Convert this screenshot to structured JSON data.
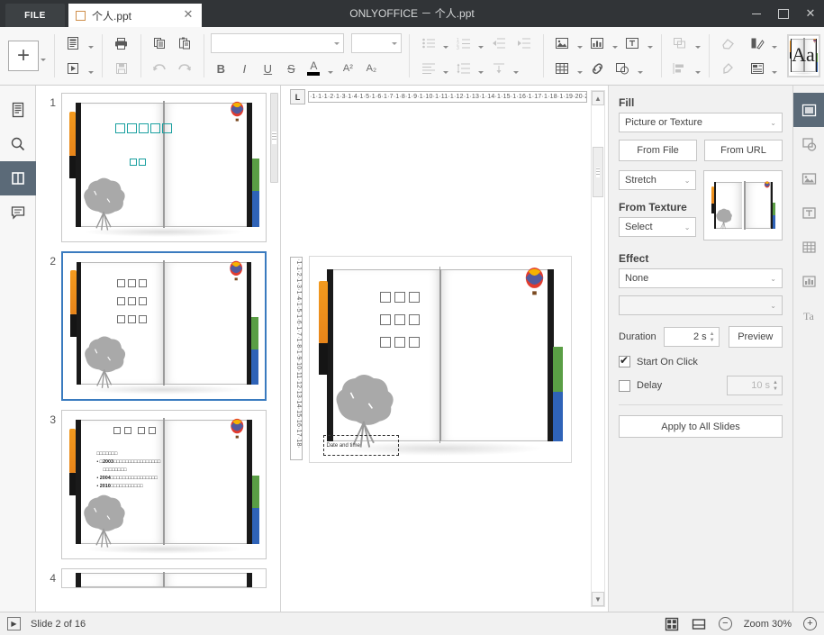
{
  "titlebar": {
    "file_label": "FILE",
    "tab_name": "个人.ppt",
    "tab_close": "✕",
    "window_title": "ONLYOFFICE － 个人.ppt",
    "minimize": "",
    "maximize": "",
    "close": "✕"
  },
  "toolbar": {
    "add_slide": "add-slide",
    "slide_layout": "slide-layout",
    "transition": "transition",
    "print": "print",
    "save": "save",
    "copy": "copy",
    "paste": "paste",
    "undo": "undo",
    "redo": "redo",
    "font_name": "",
    "font_name_placeholder": "",
    "font_size": "",
    "font_size_placeholder": "",
    "bold": "B",
    "italic": "I",
    "underline": "U",
    "strikethrough": "S",
    "font_color_letter": "A",
    "superscript": "A²",
    "subscript": "A₂",
    "bullets": "bullets",
    "numbering": "numbering",
    "decrease_indent": "decrease-indent",
    "increase_indent": "increase-indent",
    "align": "align",
    "line_spacing": "line-spacing",
    "vertical_align": "vertical-align",
    "insert_image": "insert-image",
    "insert_chart": "insert-chart",
    "insert_textbox": "insert-textbox",
    "insert_table": "insert-table",
    "hyperlink": "hyperlink",
    "insert_shape": "insert-shape",
    "arrange": "arrange",
    "align_objects": "align-objects",
    "clear_style": "clear-style",
    "copy_style": "copy-style",
    "color_scheme": "color-scheme",
    "slide_size": "slide-size",
    "theme_label": "Aa"
  },
  "left_rail": {
    "items": [
      {
        "name": "sidebar-item-outline",
        "icon": "document-icon",
        "active": false
      },
      {
        "name": "sidebar-item-search",
        "icon": "search-icon",
        "active": false
      },
      {
        "name": "sidebar-item-slide-settings",
        "icon": "slide-settings-icon",
        "active": true
      },
      {
        "name": "sidebar-item-comments",
        "icon": "comment-icon",
        "active": false
      }
    ]
  },
  "right_rail": {
    "items": [
      {
        "name": "panel-slide-settings",
        "icon": "slide-settings-icon",
        "active": true,
        "enabled": true
      },
      {
        "name": "panel-shape-settings",
        "icon": "shape-icon",
        "active": false,
        "enabled": false
      },
      {
        "name": "panel-image-settings",
        "icon": "image-icon",
        "active": false,
        "enabled": false
      },
      {
        "name": "panel-textart-settings",
        "icon": "textart-icon",
        "active": false,
        "enabled": false
      },
      {
        "name": "panel-table-settings",
        "icon": "table-icon",
        "active": false,
        "enabled": false
      },
      {
        "name": "panel-chart-settings",
        "icon": "chart-icon",
        "active": false,
        "enabled": false
      },
      {
        "name": "panel-text-settings",
        "icon": "text-icon",
        "active": false,
        "enabled": false
      }
    ]
  },
  "thumbnails": [
    {
      "number": "1",
      "selected": false,
      "title_boxes": 5,
      "subtitle_boxes": 2,
      "layout": "title"
    },
    {
      "number": "2",
      "selected": true,
      "rows": [
        3,
        3,
        3
      ],
      "layout": "bullets-plain"
    },
    {
      "number": "3",
      "selected": false,
      "title_boxes": 4,
      "bullets": [
        {
          "text": "□□□□□□□",
          "bold_prefix": ""
        },
        {
          "text": "□2003□□□□□□□□□□□□□□□□□",
          "bold_prefix": "2003"
        },
        {
          "text": "□□□□□□□□",
          "bold_prefix": ""
        },
        {
          "text": "2004□□□□□□□□□□□□□□□□",
          "bold_prefix": "2004"
        },
        {
          "text": "2010□□□□□□□□□□□",
          "bold_prefix": "2010"
        }
      ],
      "layout": "content"
    },
    {
      "number": "4",
      "selected": false,
      "layout": "partial"
    }
  ],
  "workspace": {
    "tab_stop_marker": "L",
    "h_ruler_ticks": "·1·1·1·2·1·3·1·4·1·5·1·6·1·7·1·8·1·9·1·10·1·11·1·12·1·13·1·14·1·15·1·16·1·17·1·18·1·19·20·21·22·23·24·",
    "v_ruler_ticks": "·1·1·2·1·3·1·4·1·5·1·6·1·7·1·8·1·9·10·11·12·13·14·15·16·17·18·",
    "scroll_up": "▲",
    "scroll_down": "▼",
    "slide_placeholder": "Date and time",
    "content_rows": [
      3,
      3,
      3
    ]
  },
  "right_panel": {
    "fill_label": "Fill",
    "fill_type": "Picture or Texture",
    "from_file_label": "From File",
    "from_url_label": "From URL",
    "stretch_value": "Stretch",
    "from_texture_label": "From Texture",
    "texture_select": "Select",
    "effect_label": "Effect",
    "effect_value": "None",
    "effect_option_value": "",
    "duration_label": "Duration",
    "duration_value": "2 s",
    "preview_label": "Preview",
    "start_on_click_label": "Start On Click",
    "start_on_click_checked": true,
    "delay_label": "Delay",
    "delay_checked": false,
    "delay_value": "10 s",
    "apply_all_label": "Apply to All Slides"
  },
  "status_bar": {
    "start_slideshow": "start-slideshow",
    "slide_counter": "Slide 2 of 16",
    "view_normal": "normal-view-icon",
    "view_notes": "notes-view-icon",
    "zoom_out": "−",
    "zoom_label": "Zoom 30%",
    "zoom_in": "+"
  },
  "colors": {
    "titlebar_bg": "#313437",
    "accent_selected": "#3a7bbf",
    "rail_active": "#5b6a78",
    "pen_orange": "#f29a1e",
    "tab_green": "#5a9e45",
    "tab_blue": "#2f63b8",
    "slide1_text": "#1aa0a0"
  }
}
